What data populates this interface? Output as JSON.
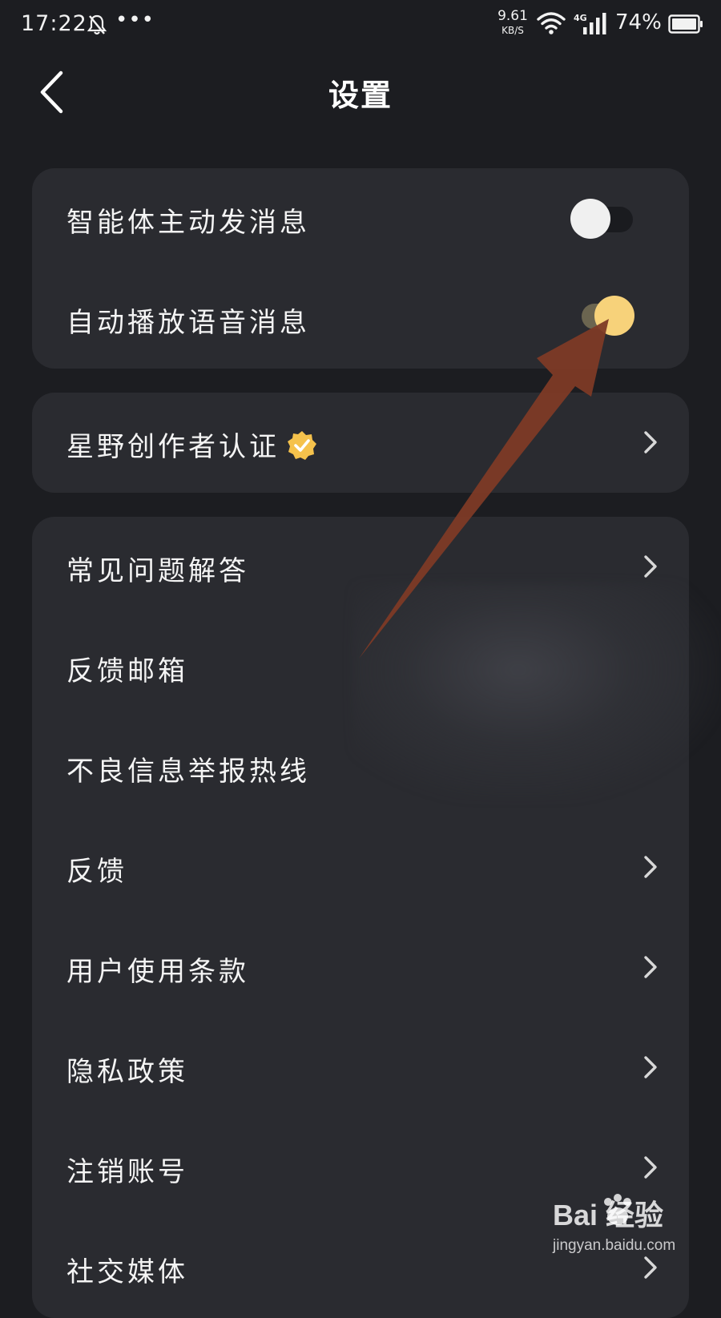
{
  "status_bar": {
    "time": "17:22",
    "more": "•••",
    "speed_value": "9.61",
    "speed_unit": "KB/S",
    "network": "4G",
    "battery": "74%"
  },
  "header": {
    "title": "设置"
  },
  "toggles": [
    {
      "label": "智能体主动发消息",
      "state": "off"
    },
    {
      "label": "自动播放语音消息",
      "state": "on"
    }
  ],
  "creator": {
    "label": "星野创作者认证"
  },
  "menu": [
    {
      "label": "常见问题解答",
      "chevron": true
    },
    {
      "label": "反馈邮箱",
      "chevron": false
    },
    {
      "label": "不良信息举报热线",
      "chevron": false
    },
    {
      "label": "反馈",
      "chevron": true
    },
    {
      "label": "用户使用条款",
      "chevron": true
    },
    {
      "label": "隐私政策",
      "chevron": true
    },
    {
      "label": "注销账号",
      "chevron": true
    },
    {
      "label": "社交媒体",
      "chevron": true
    }
  ],
  "watermark": {
    "brand": "Bai  经验",
    "url": "jingyan.baidu.com"
  },
  "colors": {
    "background": "#1c1d21",
    "card": "#2a2b30",
    "accent": "#f7d27a",
    "toggle_on_track": "#6b6550",
    "badge": "#f5c24c",
    "arrow": "#7d3a26"
  }
}
